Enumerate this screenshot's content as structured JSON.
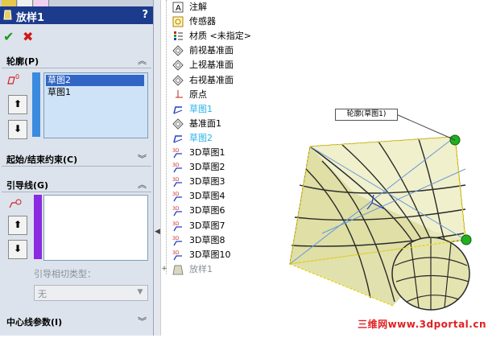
{
  "property_manager": {
    "title": "放样1",
    "help": "?",
    "profile": {
      "label": "轮廓(P)",
      "items": [
        "草图2",
        "草图1"
      ],
      "selected_index": 0
    },
    "start_end": {
      "label": "起始/结束约束(C)"
    },
    "guide": {
      "label": "引导线(G)",
      "tangency_label": "引导相切类型：",
      "tangency_value": "无"
    },
    "centerline": {
      "label": "中心线参数(I)"
    }
  },
  "tree": {
    "items": [
      {
        "label": "注解",
        "icon": "annotation-icon"
      },
      {
        "label": "传感器",
        "icon": "sensor-icon"
      },
      {
        "label": "材质 <未指定>",
        "icon": "material-icon"
      },
      {
        "label": "前视基准面",
        "icon": "plane-icon"
      },
      {
        "label": "上视基准面",
        "icon": "plane-icon"
      },
      {
        "label": "右视基准面",
        "icon": "plane-icon"
      },
      {
        "label": "原点",
        "icon": "origin-icon"
      },
      {
        "label": "草图1",
        "icon": "sketch-icon"
      },
      {
        "label": "基准面1",
        "icon": "plane-icon"
      },
      {
        "label": "草图2",
        "icon": "sketch-icon"
      },
      {
        "label": "3D草图1",
        "icon": "3dsketch-icon"
      },
      {
        "label": "3D草图2",
        "icon": "3dsketch-icon"
      },
      {
        "label": "3D草图3",
        "icon": "3dsketch-icon"
      },
      {
        "label": "3D草图4",
        "icon": "3dsketch-icon"
      },
      {
        "label": "3D草图6",
        "icon": "3dsketch-icon"
      },
      {
        "label": "3D草图7",
        "icon": "3dsketch-icon"
      },
      {
        "label": "3D草图8",
        "icon": "3dsketch-icon"
      },
      {
        "label": "3D草图10",
        "icon": "3dsketch-icon"
      },
      {
        "label": "放样1",
        "icon": "loft-icon"
      }
    ]
  },
  "graphics": {
    "callout": "轮廓(草图1)",
    "watermark": "三维网www.3dportal.cn"
  },
  "colors": {
    "title_bg": "#1c3b8c",
    "selection": "#3165c5",
    "highlight_text": "#2ab3e8",
    "guide_bar": "#8a2be2",
    "profile_bar": "#3a8be0"
  }
}
